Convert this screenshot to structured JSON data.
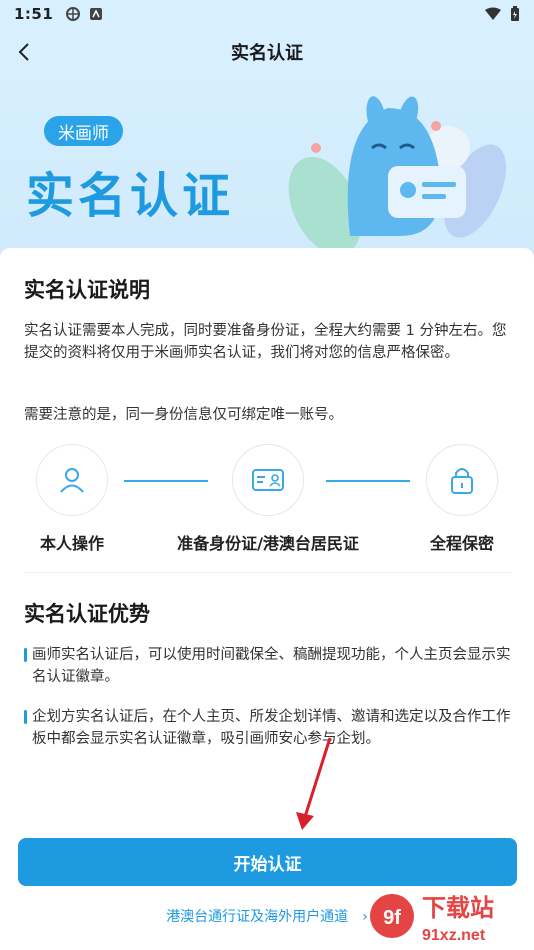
{
  "status_bar": {
    "time": "1:51"
  },
  "nav": {
    "title": "实名认证"
  },
  "hero": {
    "badge": "米画师",
    "headline": "实名认证"
  },
  "section1": {
    "title": "实名认证说明",
    "para1": "实名认证需要本人完成，同时要准备身份证，全程大约需要 1 分钟左右。您提交的资料将仅用于米画师实名认证，我们将对您的信息严格保密。",
    "para2": "需要注意的是，同一身份信息仅可绑定唯一账号。"
  },
  "steps": [
    {
      "label": "本人操作",
      "icon": "person-icon"
    },
    {
      "label": "准备身份证/港澳台居民证",
      "icon": "id-card-icon"
    },
    {
      "label": "全程保密",
      "icon": "lock-icon"
    }
  ],
  "section2": {
    "title": "实名认证优势",
    "bullets": [
      "画师实名认证后，可以使用时间戳保全、稿酬提现功能，个人主页会显示实名认证徽章。",
      "企划方实名认证后，在个人主页、所发企划详情、邀请和选定以及合作工作板中都会显示实名认证徽章，吸引画师安心参与企划。"
    ]
  },
  "cta": {
    "label": "开始认证"
  },
  "footer_link": {
    "label": "港澳台通行证及海外用户通道"
  },
  "watermark": {
    "text": "下载站",
    "site": "91xz.net"
  },
  "colors": {
    "accent": "#1e9ae0",
    "hero_bg": "#d7efff"
  }
}
